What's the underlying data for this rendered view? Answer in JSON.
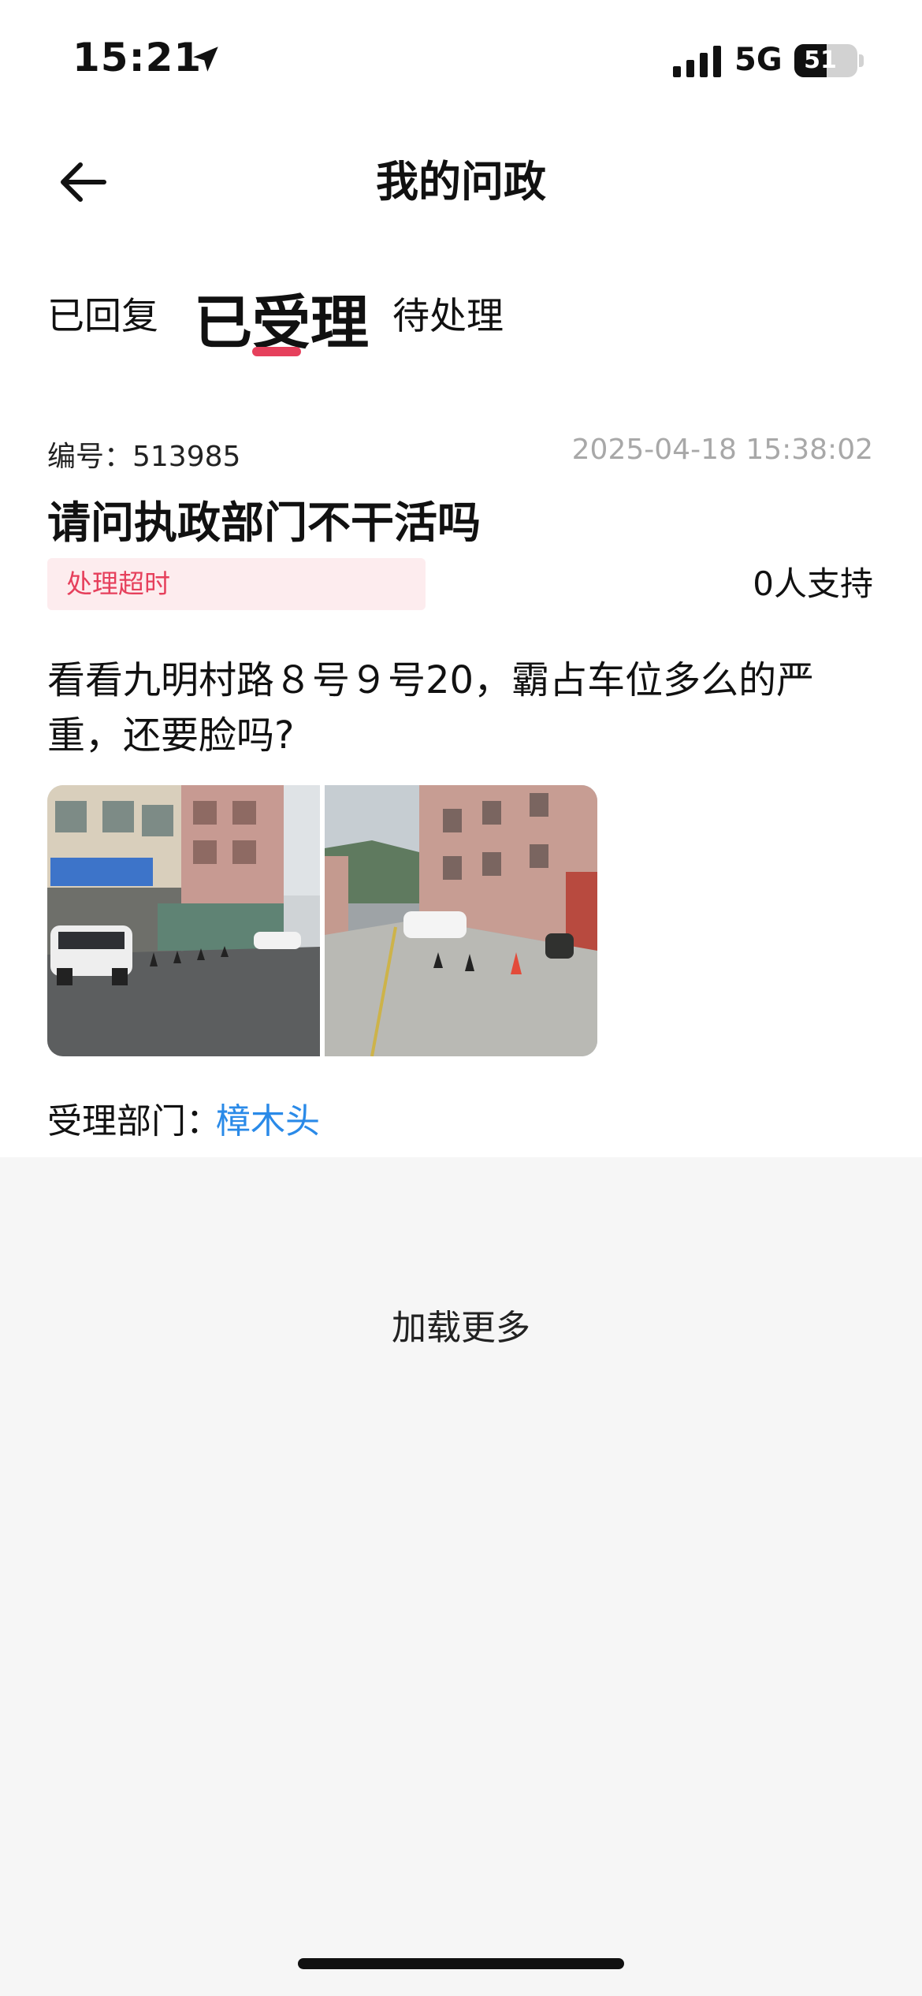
{
  "status_bar": {
    "time": "15:21",
    "network": "5G",
    "battery_level": "51",
    "battery_fraction": 0.51
  },
  "header": {
    "title": "我的问政"
  },
  "tabs": [
    {
      "label": "已回复",
      "active": false
    },
    {
      "label": "已受理",
      "active": true
    },
    {
      "label": "待处理",
      "active": false
    }
  ],
  "item": {
    "number": "编号：513985",
    "time": "2025-04-18 15:38:02",
    "title": "请问执政部门不干活吗",
    "status": "处理超时",
    "support": "0人支持",
    "content": "看看九明村路８号９号20，霸占车位多么的严重，还要脸吗?",
    "department_label": "受理部门：",
    "department": "樟木头"
  },
  "load_more": "加载更多",
  "colors": {
    "accent": "#e6405c",
    "link": "#2a8ae8",
    "badge_bg": "#fdecee"
  }
}
